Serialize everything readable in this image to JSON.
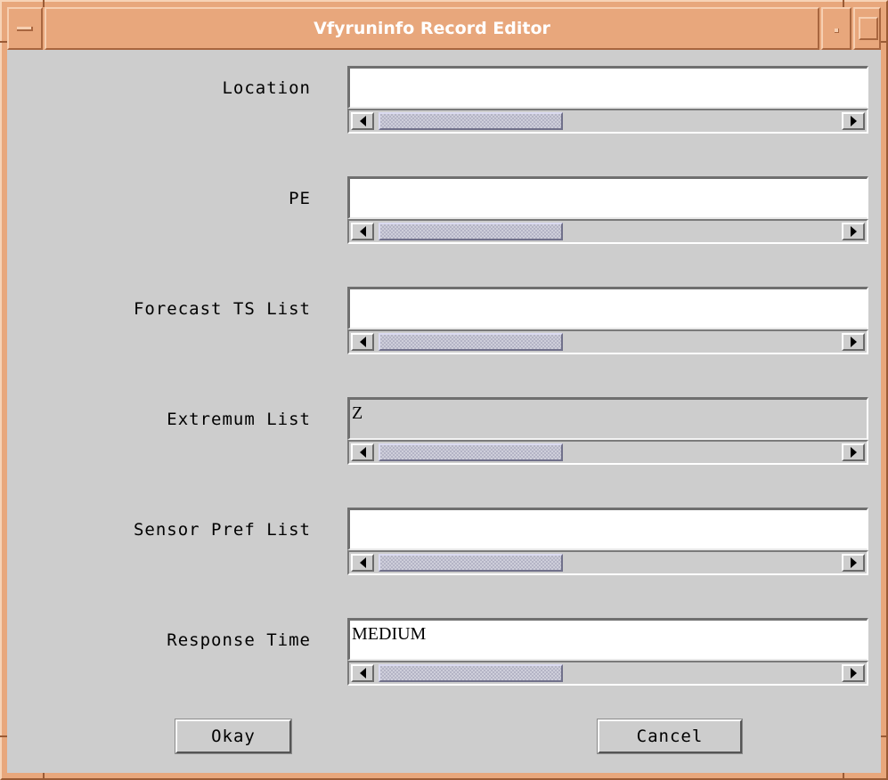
{
  "window": {
    "title": "Vfyruninfo Record Editor"
  },
  "fields": [
    {
      "label": "Location",
      "value": "",
      "enabled": true
    },
    {
      "label": "PE",
      "value": "",
      "enabled": true
    },
    {
      "label": "Forecast TS List",
      "value": "",
      "enabled": true
    },
    {
      "label": "Extremum List",
      "value": "Z",
      "enabled": false
    },
    {
      "label": "Sensor Pref List",
      "value": "",
      "enabled": true
    },
    {
      "label": "Response Time",
      "value": "MEDIUM",
      "enabled": true
    }
  ],
  "buttons": {
    "okay": "Okay",
    "cancel": "Cancel"
  },
  "colors": {
    "title_bar": "#e8a77c",
    "client_background": "#cdcdcd",
    "scroll_thumb": "#b4b4c6"
  },
  "icons": {
    "window_menu": "window-menu-icon",
    "minimize": "minimize-icon",
    "maximize": "maximize-icon",
    "scroll_left": "arrow-left-icon",
    "scroll_right": "arrow-right-icon"
  }
}
